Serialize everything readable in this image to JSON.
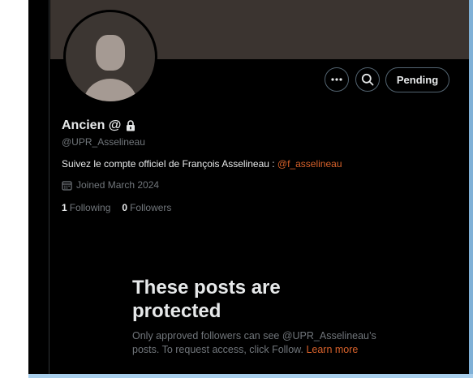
{
  "profile": {
    "name": "Ancien @",
    "handle": "@UPR_Asselineau",
    "bio_text": "Suivez le compte officiel de François Asselineau : ",
    "bio_mention": "@f_asselineau",
    "joined": "Joined March 2024",
    "following_count": "1",
    "following_label": "Following",
    "followers_count": "0",
    "followers_label": "Followers"
  },
  "actions": {
    "more_icon": "more-horizontal-icon",
    "search_icon": "search-icon",
    "pending_label": "Pending"
  },
  "protected": {
    "title": "These posts are protected",
    "description": "Only approved followers can see @UPR_Asselineau’s posts. To request access, click Follow. ",
    "learn_more": "Learn more"
  },
  "colors": {
    "background": "#000000",
    "banner": "#3b3430",
    "accent": "#d9622b",
    "muted_text": "#71767b",
    "primary_text": "#e7e9ea"
  }
}
